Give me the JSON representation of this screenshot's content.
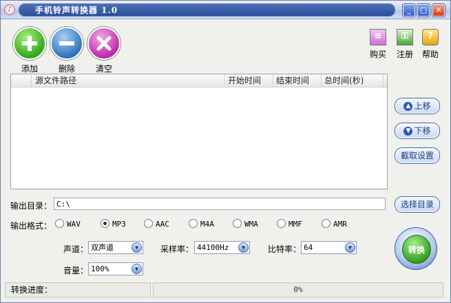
{
  "window": {
    "title": "手机铃声转换器 1.0",
    "title_text": "手机铃声转换器 1.0"
  },
  "toolbar": {
    "add": "添加",
    "delete": "删除",
    "clear": "清空",
    "buy": "购买",
    "register": "注册",
    "help": "帮助"
  },
  "file_list": {
    "columns": [
      "源文件路径",
      "开始时间",
      "结束时间",
      "总时间(秒)"
    ],
    "rows": []
  },
  "side": {
    "move_up": "上移",
    "move_down": "下移",
    "cut_settings": "截取设置",
    "select_dir": "选择目录"
  },
  "output": {
    "dir_label": "输出目录：",
    "dir_value": "C:\\",
    "format_label": "输出格式：",
    "formats": [
      "WAV",
      "MP3",
      "AAC",
      "M4A",
      "WMA",
      "MMF",
      "AMR"
    ],
    "selected_format": "MP3"
  },
  "settings": {
    "channel_label": "声道：",
    "channel_value": "双声道",
    "sample_rate_label": "采样率：",
    "sample_rate_value": "44100Hz",
    "bitrate_label": "比特率：",
    "bitrate_value": "64",
    "volume_label": "音量：",
    "volume_value": "100%"
  },
  "convert": {
    "label": "转换"
  },
  "status": {
    "progress_label": "转换进度：",
    "progress_value": "0%",
    "progress": 0
  },
  "colors": {
    "accent": "#2c4f9a",
    "title_bar": "#c9d6ee",
    "close": "#d23b17"
  }
}
